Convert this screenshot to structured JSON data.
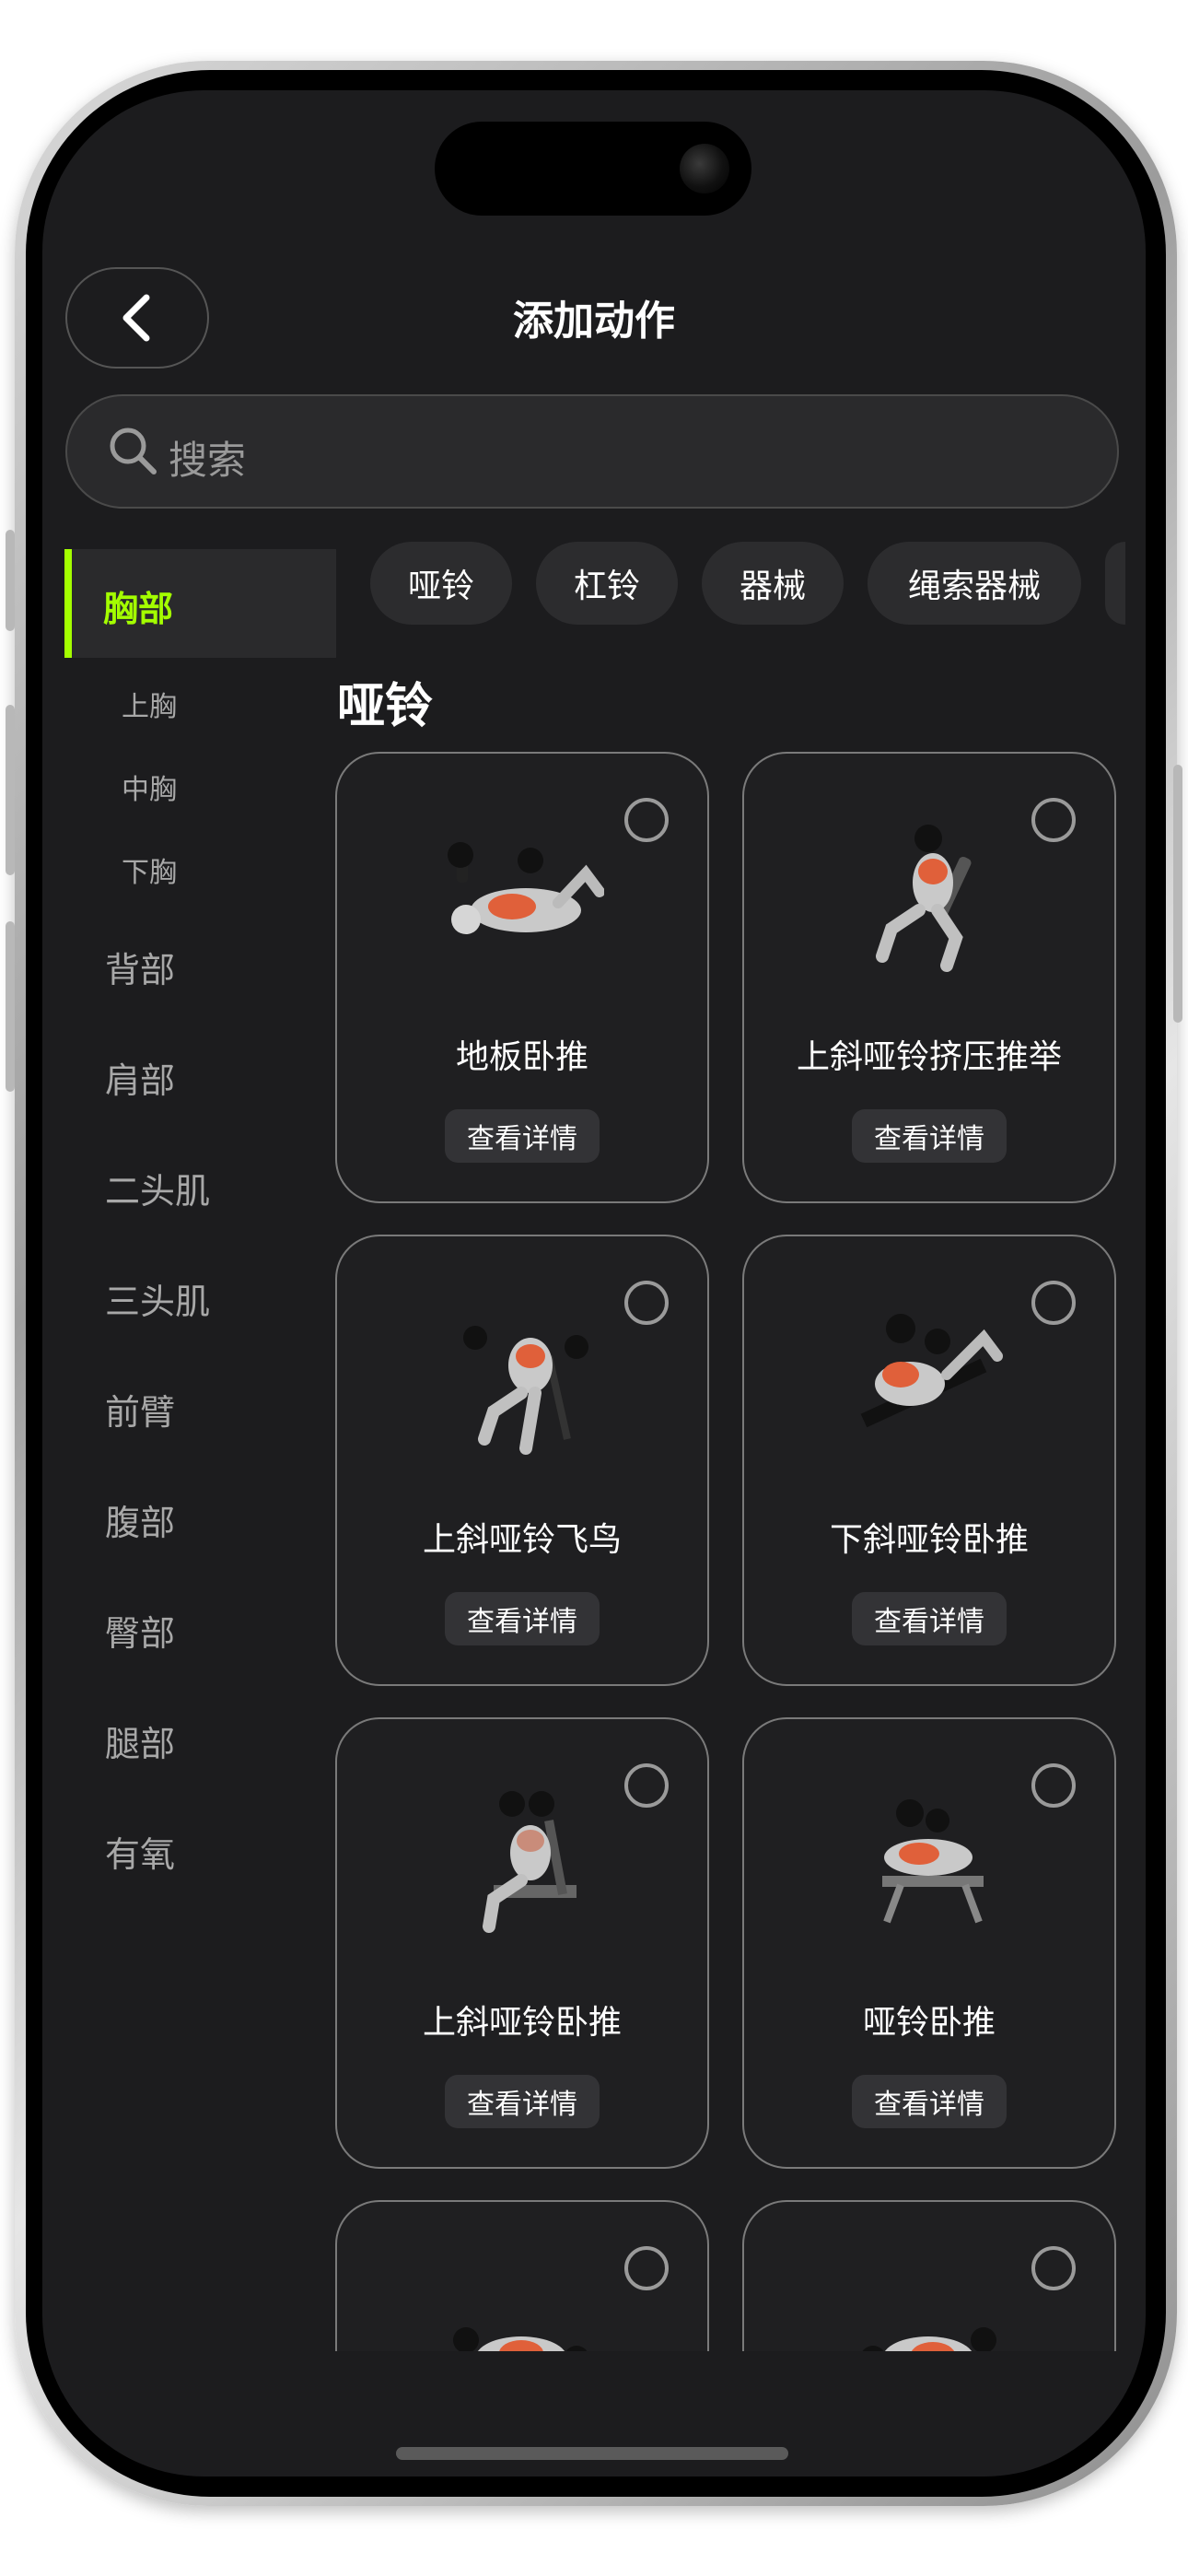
{
  "header": {
    "title": "添加动作"
  },
  "search": {
    "placeholder": "搜索"
  },
  "sidebar": {
    "active": "胸部",
    "sub_items": [
      "上胸",
      "中胸",
      "下胸"
    ],
    "items": [
      "背部",
      "肩部",
      "二头肌",
      "三头肌",
      "前臂",
      "腹部",
      "臀部",
      "腿部",
      "有氧"
    ]
  },
  "chips": [
    "哑铃",
    "杠铃",
    "器械",
    "绳索器械"
  ],
  "section": {
    "title": "哑铃"
  },
  "detail_label": "查看详情",
  "exercises": [
    {
      "name": "地板卧推"
    },
    {
      "name": "上斜哑铃挤压推举"
    },
    {
      "name": "上斜哑铃飞鸟"
    },
    {
      "name": "下斜哑铃卧推"
    },
    {
      "name": "上斜哑铃卧推"
    },
    {
      "name": "哑铃卧推"
    }
  ],
  "colors": {
    "accent": "#a4ff00",
    "background": "#1c1c1e",
    "muscle": "#e0603a"
  }
}
